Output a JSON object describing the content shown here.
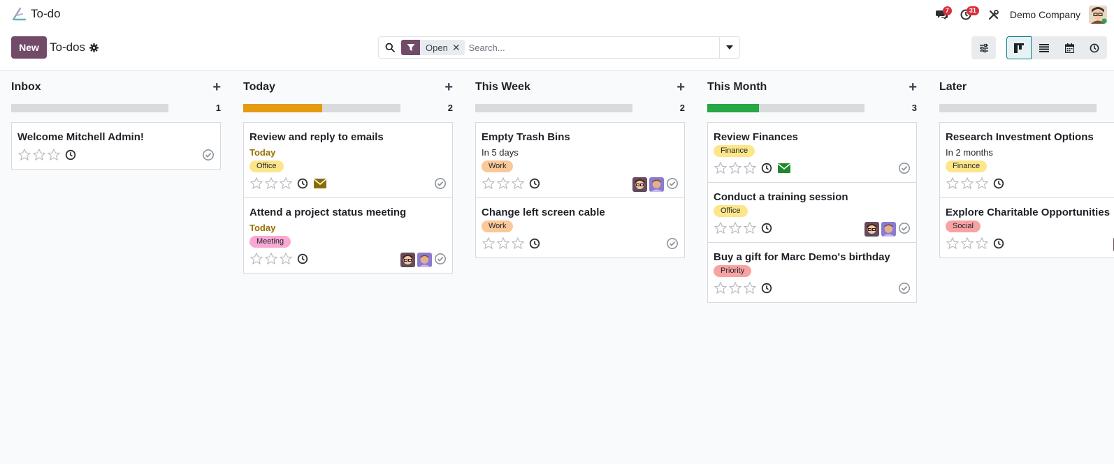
{
  "app": {
    "title": "To-do",
    "company": "Demo Company",
    "messages_count": "7",
    "activities_count": "31"
  },
  "control": {
    "new_label": "New",
    "breadcrumb": "To-dos",
    "facet_value": "Open",
    "search_placeholder": "Search..."
  },
  "colors": {
    "primary": "#714b67",
    "accent": "#017e84",
    "progress_today": "#e49b0f",
    "progress_month": "#28a745",
    "today_text": "#9a6e00"
  },
  "columns": [
    {
      "title": "Inbox",
      "count": "1",
      "progress": 0,
      "progress_color": "",
      "cards": [
        {
          "title": "Welcome Mitchell Admin!",
          "date": "",
          "date_style": "",
          "tag": "",
          "tag_color": "",
          "mail": "",
          "avatars": 0
        }
      ]
    },
    {
      "title": "Today",
      "count": "2",
      "progress": 0.5,
      "progress_color": "#e49b0f",
      "cards": [
        {
          "title": "Review and reply to emails",
          "date": "Today",
          "date_style": "today",
          "tag": "Office",
          "tag_color": "#fde68a",
          "mail": "#8a6d00",
          "avatars": 0
        },
        {
          "title": "Attend a project status meeting",
          "date": "Today",
          "date_style": "today",
          "tag": "Meeting",
          "tag_color": "#f9a8d4",
          "mail": "",
          "avatars": 2
        }
      ]
    },
    {
      "title": "This Week",
      "count": "2",
      "progress": 0,
      "progress_color": "",
      "cards": [
        {
          "title": "Empty Trash Bins",
          "date": "In 5 days",
          "date_style": "plain",
          "tag": "Work",
          "tag_color": "#fbc898",
          "mail": "",
          "avatars": 2
        },
        {
          "title": "Change left screen cable",
          "date": "",
          "date_style": "",
          "tag": "Work",
          "tag_color": "#fbc898",
          "mail": "",
          "avatars": 0
        }
      ]
    },
    {
      "title": "This Month",
      "count": "3",
      "progress": 0.33,
      "progress_color": "#28a745",
      "cards": [
        {
          "title": "Review Finances",
          "date": "",
          "date_style": "",
          "tag": "Finance",
          "tag_color": "#fde68a",
          "mail": "#1e8a2b",
          "avatars": 0
        },
        {
          "title": "Conduct a training session",
          "date": "",
          "date_style": "",
          "tag": "Office",
          "tag_color": "#fde68a",
          "mail": "",
          "avatars": 2
        },
        {
          "title": "Buy a gift for Marc Demo's birthday",
          "date": "",
          "date_style": "",
          "tag": "Priority",
          "tag_color": "#f8a3a3",
          "mail": "",
          "avatars": 0
        }
      ]
    },
    {
      "title": "Later",
      "count": "",
      "progress": 0,
      "progress_color": "",
      "cards": [
        {
          "title": "Research Investment Options",
          "date": "In 2 months",
          "date_style": "plain",
          "tag": "Finance",
          "tag_color": "#fde68a",
          "mail": "",
          "avatars": 0
        },
        {
          "title": "Explore Charitable Opportunities",
          "date": "",
          "date_style": "",
          "tag": "Social",
          "tag_color": "#f8a3a3",
          "mail": "",
          "avatars": 1
        }
      ]
    }
  ]
}
